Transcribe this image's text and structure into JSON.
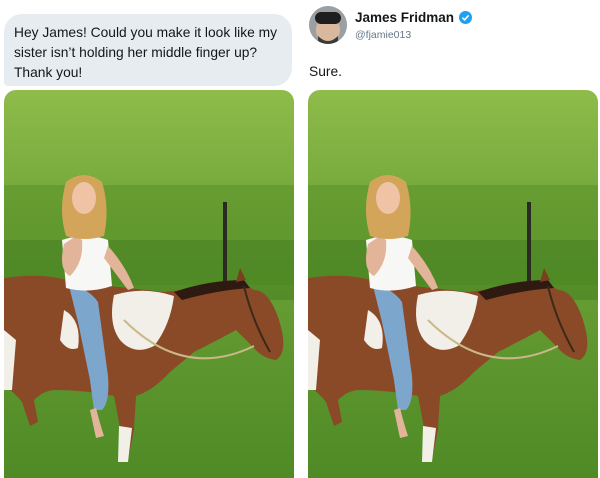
{
  "request": {
    "message": "Hey James! Could you make it look like my sister isn’t holding her middle finger up? Thank you!"
  },
  "reply": {
    "display_name": "James Fridman",
    "handle": "@fjamie013",
    "verified_icon": "verified-badge-icon",
    "text": "Sure."
  },
  "colors": {
    "bubble_bg": "#e6ecf0",
    "verified_blue": "#1da1f2",
    "grass": "#5f9a2c"
  }
}
